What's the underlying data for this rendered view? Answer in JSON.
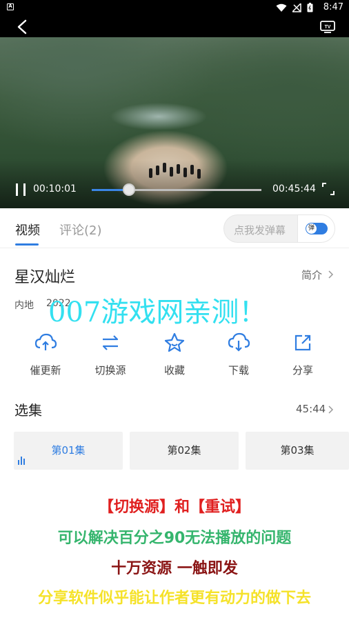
{
  "status_bar": {
    "time": "8:47",
    "sim_label": "A"
  },
  "player": {
    "current_time": "00:10:01",
    "duration": "00:45:44",
    "progress_fraction": 0.22
  },
  "tabs": [
    {
      "label": "视频"
    },
    {
      "label": "评论(2)"
    }
  ],
  "danmaku": {
    "placeholder": "点我发弹幕",
    "toggle_label": "弹",
    "toggle_on": true
  },
  "show": {
    "title": "星汉灿烂",
    "intro_link": "简介",
    "region": "内地",
    "year": "2022"
  },
  "watermark": "007游戏网亲测！",
  "actions": [
    {
      "label": "催更新",
      "icon": "cloud-refresh-icon"
    },
    {
      "label": "切换源",
      "icon": "switch-source-icon"
    },
    {
      "label": "收藏",
      "icon": "star-icon"
    },
    {
      "label": "下载",
      "icon": "cloud-download-icon"
    },
    {
      "label": "分享",
      "icon": "share-icon"
    }
  ],
  "episodes": {
    "title": "选集",
    "total_duration": "45:44",
    "items": [
      {
        "label": "第01集",
        "active": true
      },
      {
        "label": "第02集",
        "active": false
      },
      {
        "label": "第03集",
        "active": false
      }
    ]
  },
  "promo": {
    "line1": "【切换源】和【重试】",
    "line2": "可以解决百分之90无法播放的问题",
    "line3": "十万资源  一触即发",
    "line4": "分享软件似乎能让作者更有动力的做下去"
  },
  "colors": {
    "accent": "#2f7de1",
    "promo_red": "#e02020",
    "promo_green": "#35b56d",
    "promo_darkred": "#8a1414",
    "promo_yellow": "#f5e22a",
    "watermark": "#33e0f0"
  }
}
